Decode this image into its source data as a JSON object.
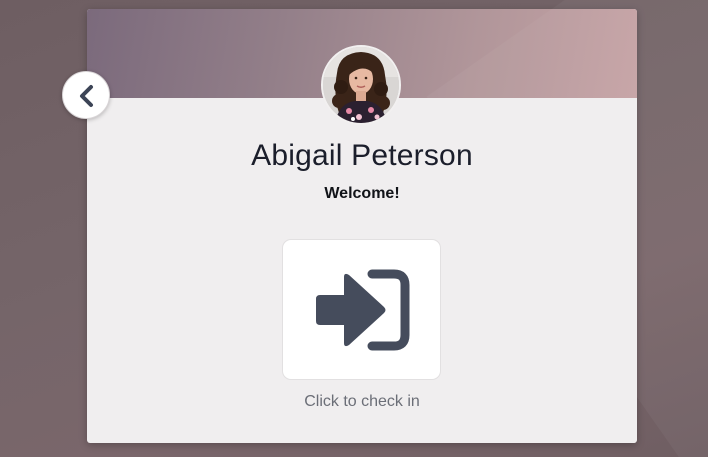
{
  "user": {
    "name": "Abigail Peterson",
    "greeting": "Welcome!"
  },
  "checkin": {
    "label": "Click to check in",
    "icon": "sign-in-icon"
  },
  "back": {
    "icon": "chevron-left-icon"
  },
  "colors": {
    "header_gradient_start": "#7b6a7c",
    "header_gradient_end": "#c6a3a5",
    "card_background": "#f0eeef",
    "icon_color": "#454c5c",
    "backdrop": "#736367"
  }
}
